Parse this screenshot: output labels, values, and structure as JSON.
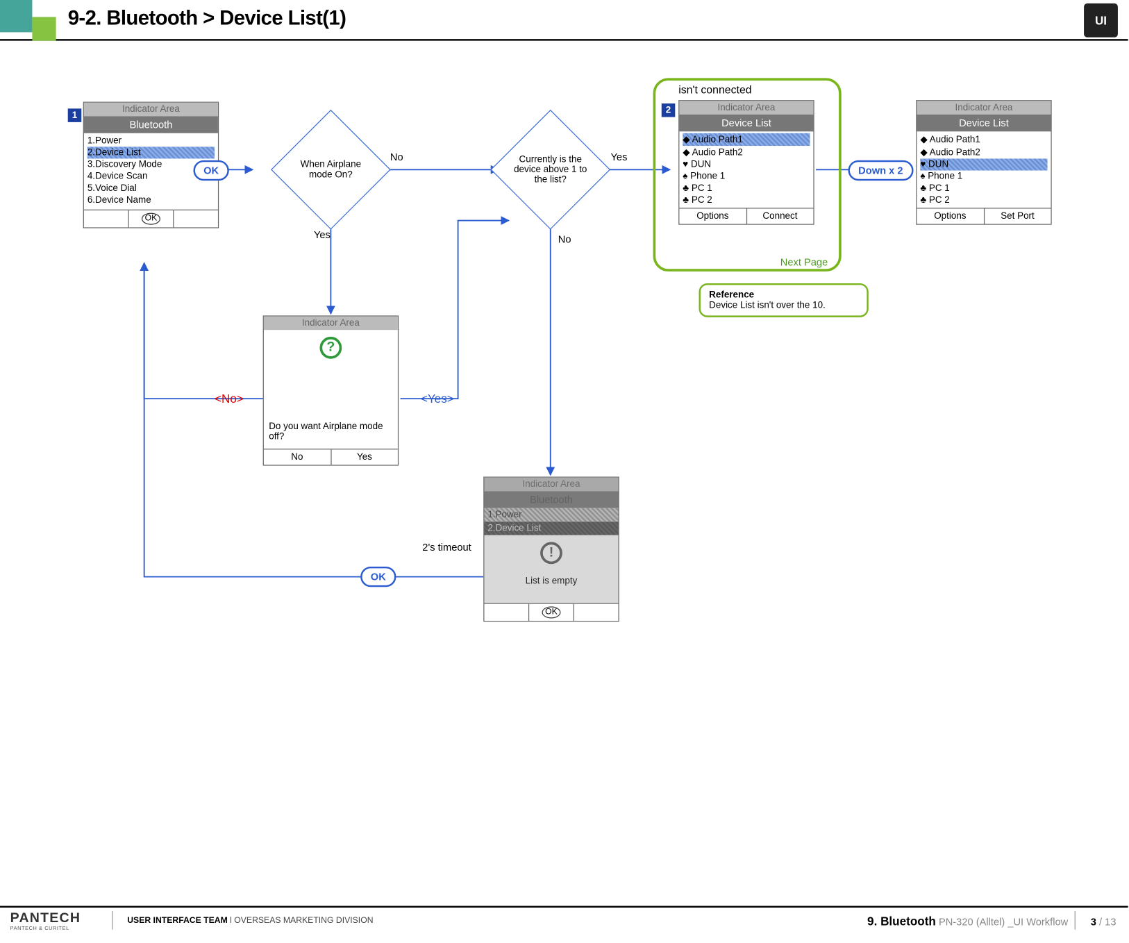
{
  "header": {
    "title": "9-2. Bluetooth > Device List(1)",
    "brand_mark": "UI"
  },
  "screens": {
    "s1": {
      "badge": "1",
      "indicator": "Indicator Area",
      "title": "Bluetooth",
      "items": [
        "1.Power",
        "2.Device List",
        "3.Discovery Mode",
        "4.Device Scan",
        "5.Voice Dial",
        "6.Device Name"
      ],
      "selected_index": 1,
      "soft_center": "OK"
    },
    "s2": {
      "badge": "2",
      "caption_above": "isn't connected",
      "indicator": "Indicator Area",
      "title": "Device List",
      "items": [
        {
          "icon": "◆",
          "label": "Audio Path1"
        },
        {
          "icon": "◆",
          "label": "Audio Path2"
        },
        {
          "icon": "♥",
          "label": "DUN"
        },
        {
          "icon": "♠",
          "label": "Phone 1"
        },
        {
          "icon": "♣",
          "label": "PC 1"
        },
        {
          "icon": "♣",
          "label": "PC 2"
        }
      ],
      "selected_index": 0,
      "soft_left": "Options",
      "soft_right": "Connect",
      "next_page": "Next Page"
    },
    "s3": {
      "indicator": "Indicator Area",
      "title": "Device List",
      "items": [
        {
          "icon": "◆",
          "label": "Audio Path1"
        },
        {
          "icon": "◆",
          "label": "Audio Path2"
        },
        {
          "icon": "♥",
          "label": "DUN"
        },
        {
          "icon": "♠",
          "label": "Phone 1"
        },
        {
          "icon": "♣",
          "label": "PC 1"
        },
        {
          "icon": "♣",
          "label": "PC 2"
        }
      ],
      "selected_index": 2,
      "soft_left": "Options",
      "soft_right": "Set Port"
    },
    "airplane_popup": {
      "indicator": "Indicator Area",
      "message": "Do you want Airplane mode off?",
      "soft_left": "No",
      "soft_right": "Yes"
    },
    "empty_popup": {
      "indicator": "Indicator Area",
      "title": "Bluetooth",
      "bg_items": [
        "1.Power",
        "2.Device List"
      ],
      "message": "List is empty",
      "soft_center": "OK"
    }
  },
  "decisions": {
    "d1": {
      "text": "When Airplane mode On?",
      "yes": "Yes",
      "no": "No"
    },
    "d2": {
      "text": "Currently is the device above 1 to the list?",
      "yes": "Yes",
      "no": "No"
    }
  },
  "pills": {
    "ok1": "OK",
    "ok2": "OK",
    "downx2": "Down x 2"
  },
  "branch_labels": {
    "no": "<No>",
    "yes": "<Yes>"
  },
  "timeout_label": "2's timeout",
  "reference": {
    "title": "Reference",
    "text": "Device List isn't over the 10."
  },
  "footer": {
    "logo_main": "PANTECH",
    "logo_sub": "PANTECH & CURITEL",
    "team_bold": "USER INTERFACE TEAM",
    "team_rest": "  l  OVERSEAS MARKETING DIVISION",
    "section": "9. Bluetooth",
    "doc": " PN-320 (Alltel) _UI Workflow",
    "page_current": "3",
    "page_total": " / 13"
  }
}
